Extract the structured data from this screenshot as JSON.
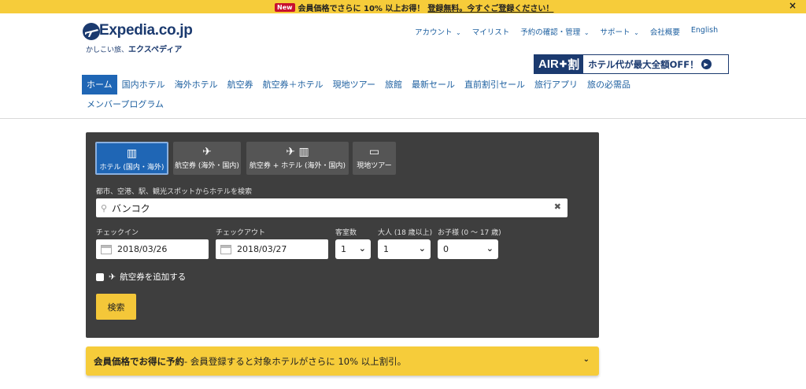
{
  "promo_bar": {
    "badge": "New",
    "message": "会員価格でさらに 10% 以上お得！",
    "link": "登録無料。今すぐご登録ください！",
    "close": "×"
  },
  "logo": {
    "brand": "Expedia.co.jp",
    "tagline_prefix": "かしこい旅、",
    "tagline_bold": "エクスペディア"
  },
  "util_nav": {
    "account": "アカウント",
    "mylist": "マイリスト",
    "booking": "予約の確認・管理",
    "support": "サポート",
    "company": "会社概要",
    "english": "English"
  },
  "air_banner": {
    "air": "AIR",
    "plus": "✚",
    "wari": "割",
    "text": "ホテル代が最大全額OFF！",
    "arrow": "▶"
  },
  "main_nav": {
    "home": "ホーム",
    "domestic_hotel": "国内ホテル",
    "overseas_hotel": "海外ホテル",
    "flights": "航空券",
    "flight_hotel": "航空券＋ホテル",
    "local_tours": "現地ツアー",
    "ryokan": "旅館",
    "sale": "最新セール",
    "last_minute": "直前割引セール",
    "app": "旅行アプリ",
    "essentials": "旅の必需品",
    "member_program": "メンバープログラム"
  },
  "search": {
    "tabs": {
      "hotel": "ホテル (国内・海外)",
      "flight": "航空券 (海外・国内)",
      "flight_hotel": "航空券 + ホテル (海外・国内)",
      "tour": "現地ツアー"
    },
    "destination_label": "都市、空港、駅、観光スポットからホテルを検索",
    "destination_value": "バンコク",
    "clear": "✖",
    "checkin_label": "チェックイン",
    "checkin_value": "2018/03/26",
    "checkout_label": "チェックアウト",
    "checkout_value": "2018/03/27",
    "rooms_label": "客室数",
    "rooms_value": "1",
    "adults_label": "大人 (18 歳以上)",
    "adults_value": "1",
    "children_label": "お子様 (0 〜 17 歳)",
    "children_value": "0",
    "add_flight": "航空券を追加する",
    "search_button": "検索"
  },
  "member_banner": {
    "bold": "会員価格でお得に予約",
    "text": " - 会員登録すると対象ホテルがさらに 10% 以上割引。"
  },
  "colors": {
    "accent_yellow": "#f6cc3a",
    "brand_blue": "#1b3a6f",
    "active_blue": "#1f66b5",
    "panel_bg": "#3e3e3e"
  }
}
